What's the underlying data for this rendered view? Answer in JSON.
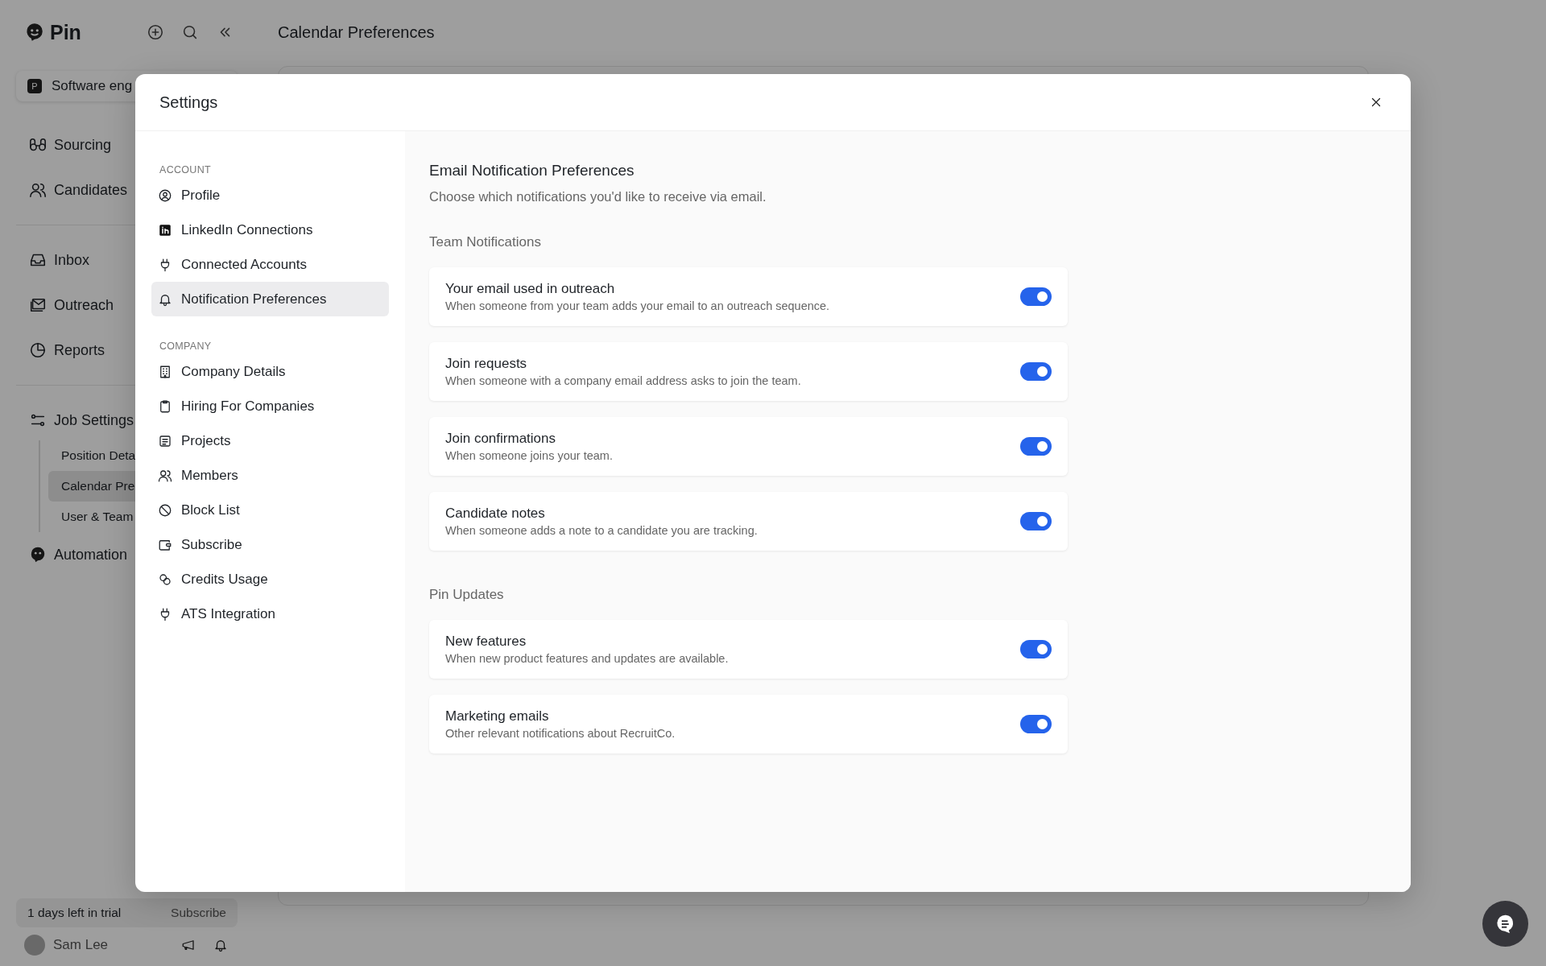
{
  "app": {
    "logo": "Pin",
    "page_title": "Calendar Preferences",
    "workspace": {
      "badge": "P",
      "name": "Software eng"
    },
    "nav_groups": [
      [
        {
          "label": "Sourcing"
        },
        {
          "label": "Candidates"
        }
      ],
      [
        {
          "label": "Inbox"
        },
        {
          "label": "Outreach"
        },
        {
          "label": "Reports"
        }
      ]
    ],
    "job_settings": {
      "label": "Job Settings",
      "children": [
        {
          "label": "Position Deta",
          "selected": false
        },
        {
          "label": "Calendar Pre",
          "selected": true
        },
        {
          "label": "User & Team",
          "selected": false
        }
      ]
    },
    "automation": "Automation",
    "trial": {
      "text": "1 days left in trial",
      "action": "Subscribe"
    },
    "user": {
      "name": "Sam Lee"
    }
  },
  "settings": {
    "title": "Settings",
    "sections": [
      {
        "heading": "ACCOUNT",
        "items": [
          {
            "label": "Profile",
            "selected": false
          },
          {
            "label": "LinkedIn Connections",
            "selected": false
          },
          {
            "label": "Connected Accounts",
            "selected": false
          },
          {
            "label": "Notification Preferences",
            "selected": true
          }
        ]
      },
      {
        "heading": "COMPANY",
        "items": [
          {
            "label": "Company Details",
            "selected": false
          },
          {
            "label": "Hiring For Companies",
            "selected": false
          },
          {
            "label": "Projects",
            "selected": false
          },
          {
            "label": "Members",
            "selected": false
          },
          {
            "label": "Block List",
            "selected": false
          },
          {
            "label": "Subscribe",
            "selected": false
          },
          {
            "label": "Credits Usage",
            "selected": false
          },
          {
            "label": "ATS Integration",
            "selected": false
          }
        ]
      }
    ],
    "content": {
      "title": "Email Notification Preferences",
      "subtitle": "Choose which notifications you'd like to receive via email.",
      "groups": [
        {
          "heading": "Team Notifications",
          "items": [
            {
              "title": "Your email used in outreach",
              "description": "When someone from your team adds your email to an outreach sequence.",
              "on": true
            },
            {
              "title": "Join requests",
              "description": "When someone with a company email address asks to join the team.",
              "on": true
            },
            {
              "title": "Join confirmations",
              "description": "When someone joins your team.",
              "on": true
            },
            {
              "title": "Candidate notes",
              "description": "When someone adds a note to a candidate you are tracking.",
              "on": true
            }
          ]
        },
        {
          "heading": "Pin Updates",
          "items": [
            {
              "title": "New features",
              "description": "When new product features and updates are available.",
              "on": true
            },
            {
              "title": "Marketing emails",
              "description": "Other relevant notifications about RecruitCo.",
              "on": true
            }
          ]
        }
      ]
    }
  }
}
